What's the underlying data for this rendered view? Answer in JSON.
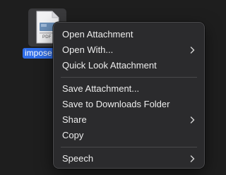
{
  "file": {
    "name": "impose",
    "type_badge": "PDF"
  },
  "context_menu": {
    "items": [
      {
        "label": "Open Attachment",
        "submenu": false
      },
      {
        "label": "Open With...",
        "submenu": true
      },
      {
        "label": "Quick Look Attachment",
        "submenu": false
      },
      {
        "label": "Save Attachment...",
        "submenu": false
      },
      {
        "label": "Save to Downloads Folder",
        "submenu": false
      },
      {
        "label": "Share",
        "submenu": true
      },
      {
        "label": "Copy",
        "submenu": false
      },
      {
        "label": "Speech",
        "submenu": true
      }
    ]
  },
  "colors": {
    "background": "#1e1e1e",
    "menu_background": "#2b2b2d",
    "selection": "#2f6de8",
    "text": "#ededed"
  }
}
